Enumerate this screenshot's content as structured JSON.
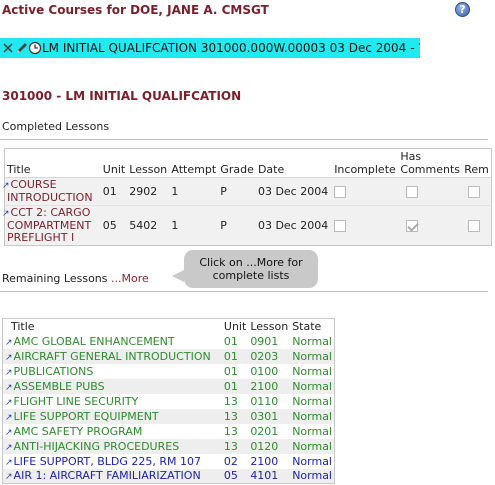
{
  "header": {
    "title": "Active Courses for DOE, JANE A. CMSGT",
    "help_icon": "question-circle-icon",
    "help_symbol": "?"
  },
  "course_bar": {
    "text": "LM INITIAL QUALIFCATION 301000.000W.00003 03 Dec 2004 - ?",
    "icons": [
      "close-x-icon",
      "pencil-icon",
      "clock-icon"
    ],
    "highlight_color": "#22e8f0"
  },
  "section": {
    "heading": "301000 - LM INITIAL QUALIFCATION",
    "completed_label": "Completed Lessons"
  },
  "completed_table": {
    "headers": [
      "Title",
      "Unit",
      "Lesson",
      "Attempt",
      "Grade",
      "Date",
      "Incomplete",
      "Has Comments",
      "Rem"
    ],
    "rows": [
      {
        "title": "COURSE INTRODUCTION",
        "unit": "01",
        "lesson": "2902",
        "attempt": "1",
        "grade": "P",
        "date": "03 Dec 2004",
        "incomplete": false,
        "has_comments": false,
        "rem": false
      },
      {
        "title": "CCT 2: CARGO COMPARTMENT PREFLIGHT I",
        "unit": "05",
        "lesson": "5402",
        "attempt": "1",
        "grade": "P",
        "date": "03 Dec 2004",
        "incomplete": false,
        "has_comments": true,
        "rem": false
      }
    ]
  },
  "remaining": {
    "label": "Remaining Lessons",
    "more_link": "...More",
    "tooltip": "Click on ...More for complete lists"
  },
  "remaining_table": {
    "headers": [
      "Title",
      "Unit",
      "Lesson",
      "State"
    ],
    "rows": [
      {
        "title": "AMC GLOBAL ENHANCEMENT",
        "unit": "01",
        "lesson": "0901",
        "state": "Normal",
        "color": "green"
      },
      {
        "title": "AIRCRAFT GENERAL INTRODUCTION",
        "unit": "01",
        "lesson": "0203",
        "state": "Normal",
        "color": "green"
      },
      {
        "title": "PUBLICATIONS",
        "unit": "01",
        "lesson": "0100",
        "state": "Normal",
        "color": "green"
      },
      {
        "title": "ASSEMBLE PUBS",
        "unit": "01",
        "lesson": "2100",
        "state": "Normal",
        "color": "green"
      },
      {
        "title": "FLIGHT LINE SECURITY",
        "unit": "13",
        "lesson": "0110",
        "state": "Normal",
        "color": "green"
      },
      {
        "title": "LIFE SUPPORT EQUIPMENT",
        "unit": "13",
        "lesson": "0301",
        "state": "Normal",
        "color": "green"
      },
      {
        "title": "AMC SAFETY PROGRAM",
        "unit": "13",
        "lesson": "0201",
        "state": "Normal",
        "color": "green"
      },
      {
        "title": "ANTI-HIJACKING PROCEDURES",
        "unit": "13",
        "lesson": "0120",
        "state": "Normal",
        "color": "green"
      },
      {
        "title": "LIFE SUPPORT, BLDG 225, RM 107",
        "unit": "02",
        "lesson": "2100",
        "state": "Normal",
        "color": "blue"
      },
      {
        "title": "AIR 1: AIRCRAFT FAMILIARIZATION",
        "unit": "05",
        "lesson": "4101",
        "state": "Normal",
        "color": "blue"
      }
    ]
  },
  "colors": {
    "heading": "#7a1f2b",
    "row_green": "#2e8b2e",
    "row_blue": "#1f22b0",
    "marker": "#2b3fa0"
  }
}
